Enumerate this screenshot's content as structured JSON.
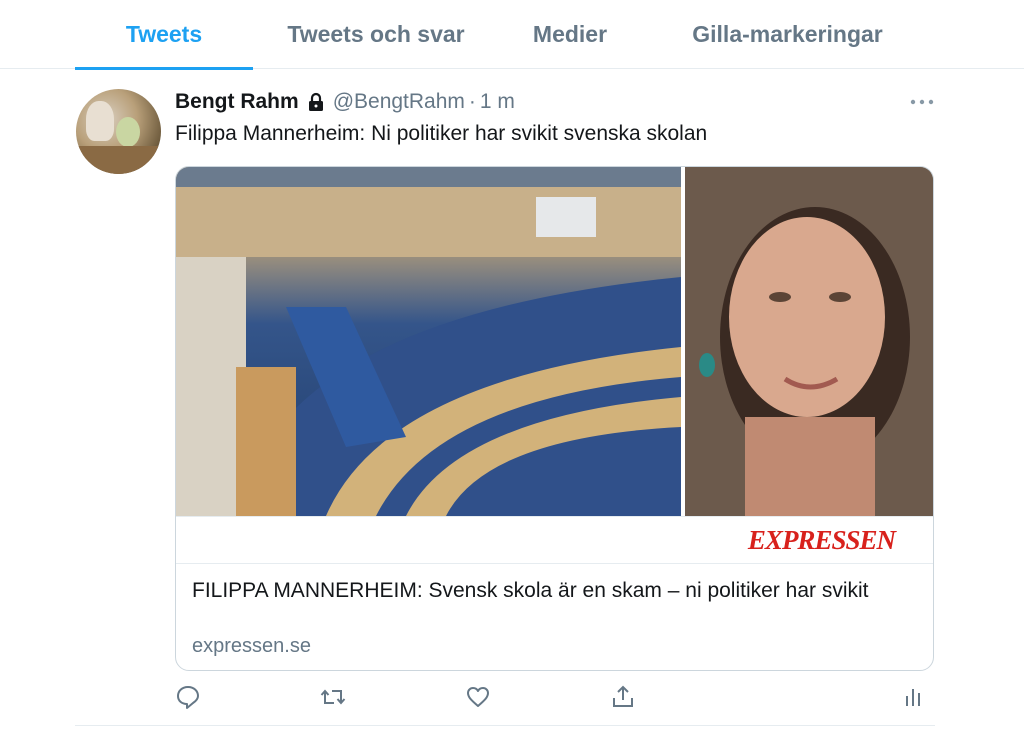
{
  "tabs": [
    {
      "label": "Tweets",
      "active": true
    },
    {
      "label": "Tweets och svar",
      "active": false
    },
    {
      "label": "Medier",
      "active": false
    },
    {
      "label": "Gilla-markeringar",
      "active": false
    }
  ],
  "tweet": {
    "author_name": "Bengt Rahm",
    "handle": "@BengtRahm",
    "separator": "·",
    "time": "1 m",
    "text": "Filippa Mannerheim: Ni politiker har svikit svenska skolan",
    "card": {
      "logo_text": "EXPRESSEN",
      "title": "FILIPPA MANNERHEIM: Svensk skola är en skam – ni politiker har svikit",
      "domain": "expressen.se"
    },
    "icons": {
      "lock": "lock-icon",
      "more": "more-icon",
      "reply": "reply-icon",
      "retweet": "retweet-icon",
      "like": "like-icon",
      "share": "share-icon",
      "analytics": "analytics-icon"
    }
  },
  "colors": {
    "accent": "#1da1f2",
    "text": "#14171a",
    "secondary": "#657786",
    "brand_red": "#d8211c"
  }
}
